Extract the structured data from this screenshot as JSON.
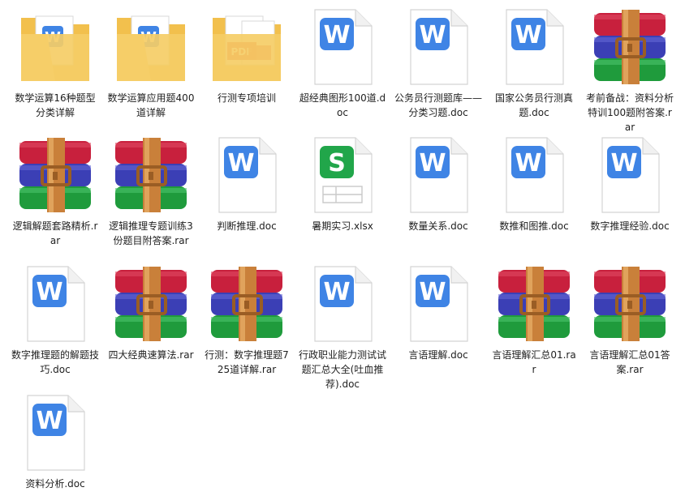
{
  "files": [
    {
      "name": "数学运算16种题型分类详解",
      "type": "folder-doc"
    },
    {
      "name": "数学运算应用题400道详解",
      "type": "folder-doc"
    },
    {
      "name": "行测专项培训",
      "type": "folder-pdf"
    },
    {
      "name": "超经典图形100道.doc",
      "type": "doc"
    },
    {
      "name": "公务员行测题库——分类习题.doc",
      "type": "doc"
    },
    {
      "name": "国家公务员行测真题.doc",
      "type": "doc"
    },
    {
      "name": "考前备战：资料分析特训100题附答案.rar",
      "type": "rar"
    },
    {
      "name": "逻辑解题套路精析.rar",
      "type": "rar"
    },
    {
      "name": "逻辑推理专题训练3份题目附答案.rar",
      "type": "rar"
    },
    {
      "name": "判断推理.doc",
      "type": "doc"
    },
    {
      "name": "暑期实习.xlsx",
      "type": "xlsx"
    },
    {
      "name": "数量关系.doc",
      "type": "doc"
    },
    {
      "name": "数推和图推.doc",
      "type": "doc"
    },
    {
      "name": "数字推理经验.doc",
      "type": "doc"
    },
    {
      "name": "数字推理题的解题技巧.doc",
      "type": "doc"
    },
    {
      "name": "四大经典速算法.rar",
      "type": "rar"
    },
    {
      "name": "行测：数字推理题725道详解.rar",
      "type": "rar"
    },
    {
      "name": "行政职业能力测试试题汇总大全(吐血推荐).doc",
      "type": "doc"
    },
    {
      "name": "言语理解.doc",
      "type": "doc"
    },
    {
      "name": "言语理解汇总01.rar",
      "type": "rar"
    },
    {
      "name": "言语理解汇总01答案.rar",
      "type": "rar"
    },
    {
      "name": "资料分析.doc",
      "type": "doc"
    }
  ],
  "icon_text": {
    "doc": "W",
    "xlsx": "S",
    "pdf": "PDF"
  }
}
